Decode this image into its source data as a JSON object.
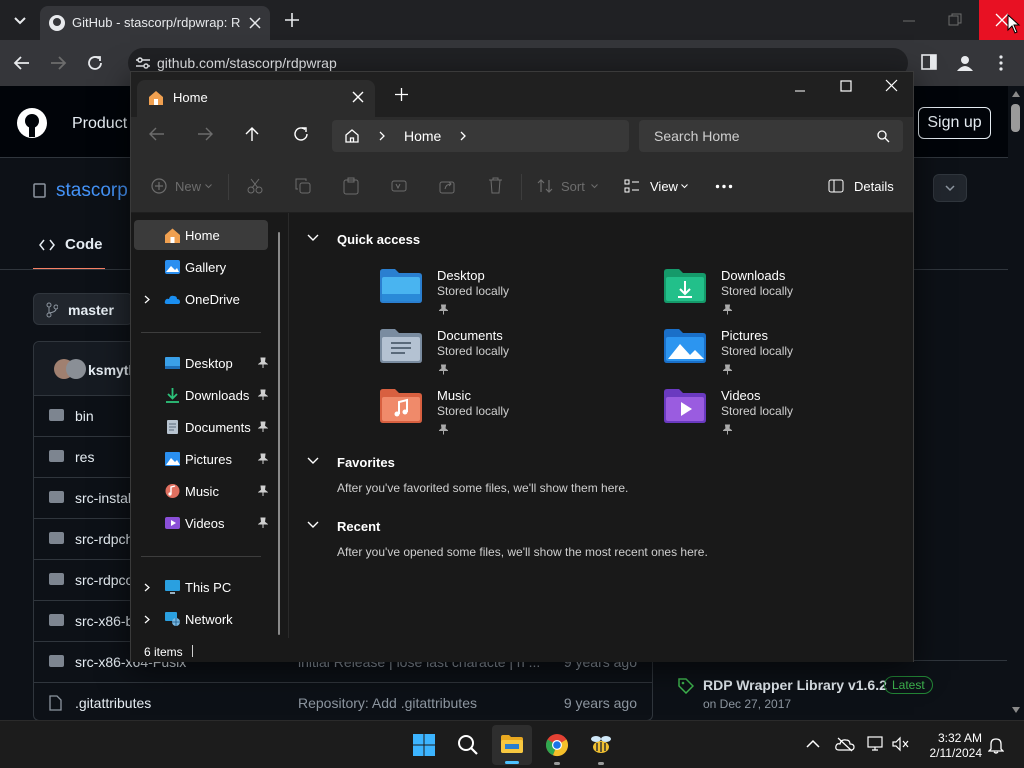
{
  "browser": {
    "tab_title": "GitHub - stascorp/rdpwrap: RD",
    "url": "github.com/stascorp/rdpwrap"
  },
  "github": {
    "nav_product": "Product",
    "signup": "Sign up",
    "repo_owner": "stascorp",
    "code_tab": "Code",
    "branch": "master",
    "commit_author": "ksmyth",
    "files": [
      {
        "name": "bin",
        "message": "",
        "age": ""
      },
      {
        "name": "res",
        "message": "",
        "age": ""
      },
      {
        "name": "src-instal",
        "message": "",
        "age": ""
      },
      {
        "name": "src-rdpch",
        "message": "",
        "age": ""
      },
      {
        "name": "src-rdpco",
        "message": "",
        "age": ""
      },
      {
        "name": "src-x86-b",
        "message": "",
        "age": ""
      },
      {
        "name": "src-x86-x64-Fusix",
        "message": "lnitial Release | lose last characte | n ...",
        "age": "9 years ago"
      },
      {
        "name": ".gitattributes",
        "message": "Repository: Add .gitattributes",
        "age": "9 years ago"
      }
    ],
    "release_name": "RDP Wrapper Library v1.6.2",
    "release_badge": "Latest",
    "release_date": "on Dec 27, 2017"
  },
  "explorer": {
    "tab_label": "Home",
    "breadcrumb": "Home",
    "search_placeholder": "Search Home",
    "commands": {
      "new": "New",
      "sort": "Sort",
      "view": "View",
      "details": "Details"
    },
    "nav": {
      "home": "Home",
      "gallery": "Gallery",
      "onedrive": "OneDrive",
      "desktop": "Desktop",
      "downloads": "Downloads",
      "documents": "Documents",
      "pictures": "Pictures",
      "music": "Music",
      "videos": "Videos",
      "thispc": "This PC",
      "network": "Network"
    },
    "quick_access": {
      "title": "Quick access",
      "items": [
        {
          "name": "Desktop",
          "sub": "Stored locally"
        },
        {
          "name": "Downloads",
          "sub": "Stored locally"
        },
        {
          "name": "Documents",
          "sub": "Stored locally"
        },
        {
          "name": "Pictures",
          "sub": "Stored locally"
        },
        {
          "name": "Music",
          "sub": "Stored locally"
        },
        {
          "name": "Videos",
          "sub": "Stored locally"
        }
      ]
    },
    "favorites": {
      "title": "Favorites",
      "empty": "After you've favorited some files, we'll show them here."
    },
    "recent": {
      "title": "Recent",
      "empty": "After you've opened some files, we'll show the most recent ones here."
    },
    "status": "6 items"
  },
  "taskbar": {
    "time": "3:32 AM",
    "date": "2/11/2024"
  },
  "colors": {
    "close_red": "#e81123",
    "accent_blue": "#4cc2ff",
    "github_bg": "#0d1117"
  }
}
